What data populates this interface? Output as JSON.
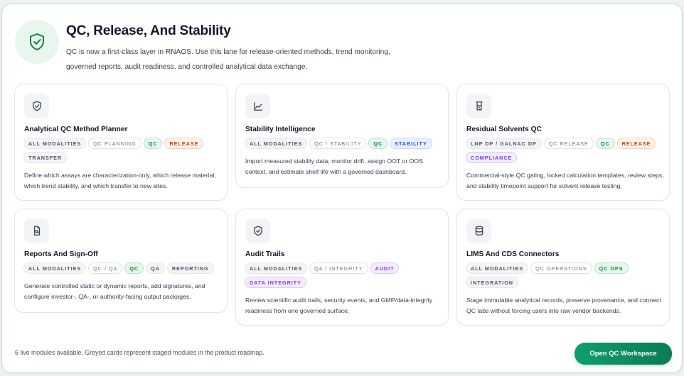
{
  "header": {
    "icon": "shield-check-icon",
    "title": "QC, Release, And Stability",
    "description": "QC is now a first-class layer in RNAOS. Use this lane for release-oriented methods, trend monitoring, governed reports, audit readiness, and controlled analytical data exchange."
  },
  "cards": [
    {
      "icon": "shield-check-icon",
      "title": "Analytical QC Method Planner",
      "tags": [
        {
          "label": "ALL MODALITIES",
          "style": "neutral"
        },
        {
          "label": "QC PLANNING",
          "style": "plain"
        },
        {
          "label": "QC",
          "style": "green"
        },
        {
          "label": "RELEASE",
          "style": "orange"
        },
        {
          "label": "TRANSFER",
          "style": "neutral"
        }
      ],
      "description": "Define which assays are characterization-only, which release material, which trend stability, and which transfer to new sites."
    },
    {
      "icon": "trend-chart-icon",
      "title": "Stability Intelligence",
      "tags": [
        {
          "label": "ALL MODALITIES",
          "style": "neutral"
        },
        {
          "label": "QC / STABILITY",
          "style": "plain"
        },
        {
          "label": "QC",
          "style": "green"
        },
        {
          "label": "STABILITY",
          "style": "blue"
        }
      ],
      "description": "Import measured stability data, monitor drift, assign OOT or OOS context, and estimate shelf life with a governed dashboard."
    },
    {
      "icon": "beaker-icon",
      "title": "Residual Solvents QC",
      "tags": [
        {
          "label": "LNP DP / GALNAC DP",
          "style": "neutral"
        },
        {
          "label": "QC RELEASE",
          "style": "plain"
        },
        {
          "label": "QC",
          "style": "green"
        },
        {
          "label": "RELEASE",
          "style": "orange"
        },
        {
          "label": "COMPLIANCE",
          "style": "purple"
        }
      ],
      "description": "Commercial-style QC gating, locked calculation templates, review steps, and stability timepoint support for solvent release testing."
    },
    {
      "icon": "report-search-icon",
      "title": "Reports And Sign-Off",
      "tags": [
        {
          "label": "ALL MODALITIES",
          "style": "neutral"
        },
        {
          "label": "QC / QA",
          "style": "plain"
        },
        {
          "label": "QC",
          "style": "green"
        },
        {
          "label": "QA",
          "style": "neutral"
        },
        {
          "label": "REPORTING",
          "style": "neutral"
        }
      ],
      "description": "Generate controlled static or dynamic reports, add signatures, and configure investor-, QA-, or authority-facing output packages."
    },
    {
      "icon": "shield-check-icon",
      "title": "Audit Trails",
      "tags": [
        {
          "label": "ALL MODALITIES",
          "style": "neutral"
        },
        {
          "label": "QA / INTEGRITY",
          "style": "plain"
        },
        {
          "label": "AUDIT",
          "style": "purple"
        },
        {
          "label": "DATA INTEGRITY",
          "style": "purple"
        }
      ],
      "description": "Review scientific audit trails, security events, and GMP/data-integrity readiness from one governed surface."
    },
    {
      "icon": "database-icon",
      "title": "LIMS And CDS Connectors",
      "tags": [
        {
          "label": "ALL MODALITIES",
          "style": "neutral"
        },
        {
          "label": "QC OPERATIONS",
          "style": "plain"
        },
        {
          "label": "QC OPS",
          "style": "green"
        },
        {
          "label": "INTEGRATION",
          "style": "neutral"
        }
      ],
      "description": "Stage immutable analytical records, preserve provenance, and connect QC labs without forcing users into raw vendor backends."
    }
  ],
  "footer": {
    "status_text": "6 live modules available. Greyed cards represent staged modules in the product roadmap.",
    "cta_label": "Open QC Workspace"
  }
}
